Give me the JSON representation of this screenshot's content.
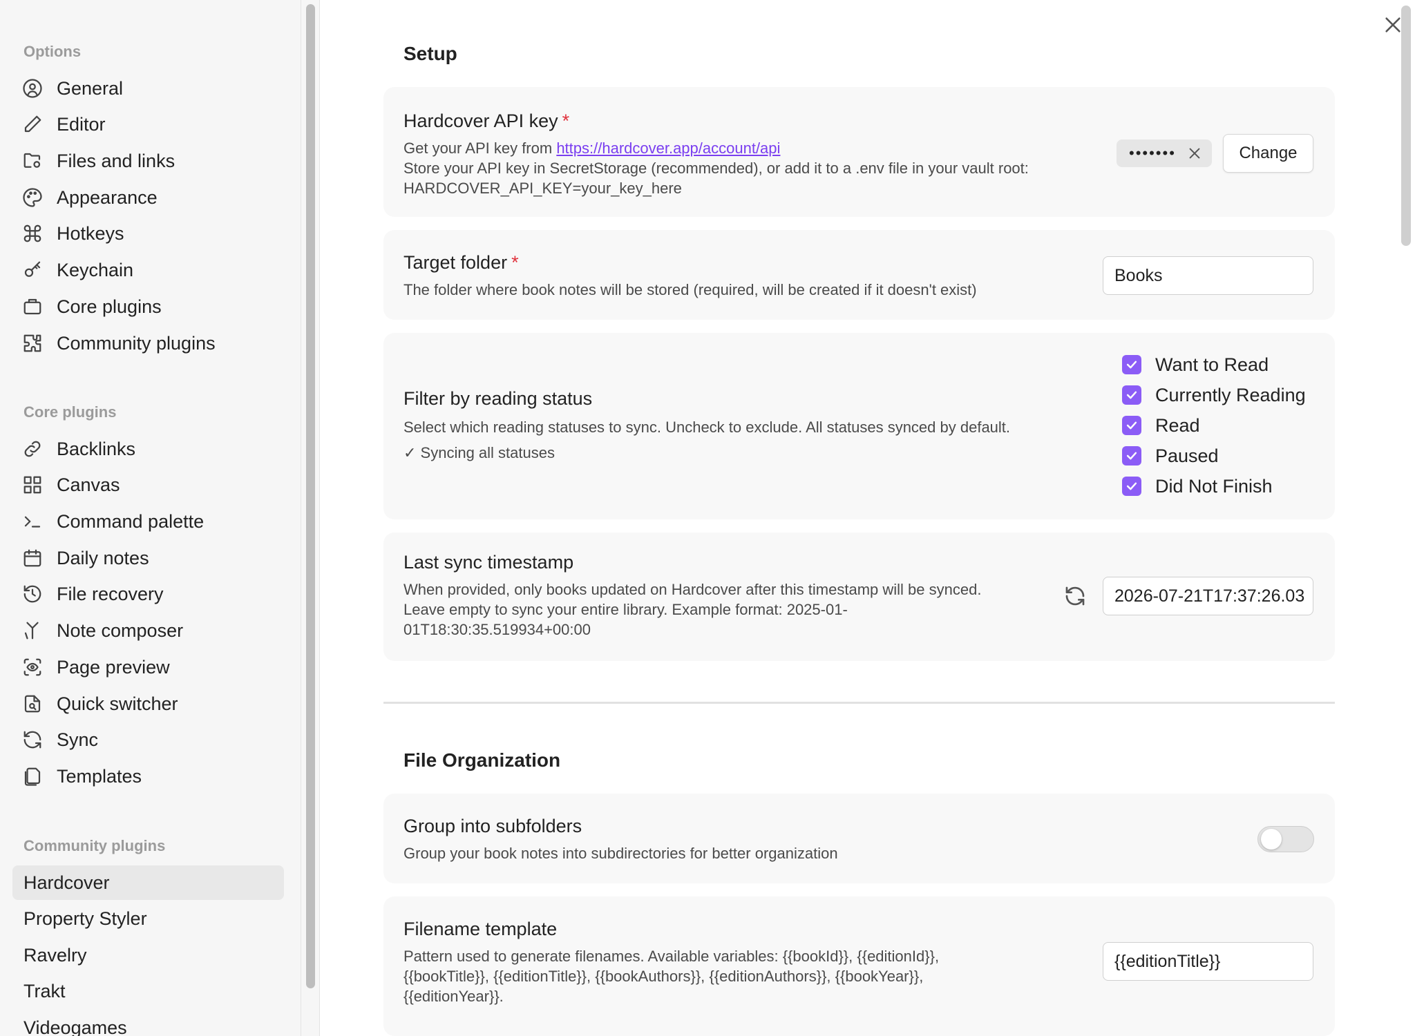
{
  "sidebar": {
    "options_title": "Options",
    "options_items": [
      {
        "label": "General",
        "icon": "user-circle-icon"
      },
      {
        "label": "Editor",
        "icon": "pencil-icon"
      },
      {
        "label": "Files and links",
        "icon": "folder-cog-icon"
      },
      {
        "label": "Appearance",
        "icon": "palette-icon"
      },
      {
        "label": "Hotkeys",
        "icon": "command-icon"
      },
      {
        "label": "Keychain",
        "icon": "key-icon"
      },
      {
        "label": "Core plugins",
        "icon": "briefcase-icon"
      },
      {
        "label": "Community plugins",
        "icon": "puzzle-icon"
      }
    ],
    "core_title": "Core plugins",
    "core_items": [
      {
        "label": "Backlinks",
        "icon": "link-icon"
      },
      {
        "label": "Canvas",
        "icon": "layout-grid-icon"
      },
      {
        "label": "Command palette",
        "icon": "terminal-icon"
      },
      {
        "label": "Daily notes",
        "icon": "calendar-icon"
      },
      {
        "label": "File recovery",
        "icon": "history-icon"
      },
      {
        "label": "Note composer",
        "icon": "merge-icon"
      },
      {
        "label": "Page preview",
        "icon": "scan-eye-icon"
      },
      {
        "label": "Quick switcher",
        "icon": "file-search-icon"
      },
      {
        "label": "Sync",
        "icon": "refresh-icon"
      },
      {
        "label": "Templates",
        "icon": "files-icon"
      }
    ],
    "community_title": "Community plugins",
    "community_items": [
      {
        "label": "Hardcover",
        "active": true
      },
      {
        "label": "Property Styler"
      },
      {
        "label": "Ravelry"
      },
      {
        "label": "Trakt"
      },
      {
        "label": "Videogames"
      }
    ]
  },
  "setup": {
    "heading": "Setup",
    "api_key": {
      "title": "Hardcover API key",
      "required_mark": "*",
      "desc_prefix": "Get your API key from ",
      "link": "https://hardcover.app/account/api",
      "desc_line2": "Store your API key in SecretStorage (recommended), or add it to a .env file in your vault root:",
      "desc_line3": "HARDCOVER_API_KEY=your_key_here",
      "masked_value": "•••••••",
      "change_label": "Change"
    },
    "target_folder": {
      "title": "Target folder",
      "required_mark": "*",
      "desc": "The folder where book notes will be stored (required, will be created if it doesn't exist)",
      "value": "Books"
    },
    "filter": {
      "title": "Filter by reading status",
      "desc": "Select which reading statuses to sync. Uncheck to exclude. All statuses synced by default.",
      "status_note": "✓ Syncing all statuses",
      "options": [
        {
          "label": "Want to Read",
          "checked": true
        },
        {
          "label": "Currently Reading",
          "checked": true
        },
        {
          "label": "Read",
          "checked": true
        },
        {
          "label": "Paused",
          "checked": true
        },
        {
          "label": "Did Not Finish",
          "checked": true
        }
      ]
    },
    "last_sync": {
      "title": "Last sync timestamp",
      "desc_line1": "When provided, only books updated on Hardcover after this timestamp will be synced.",
      "desc_line2": "Leave empty to sync your entire library. Example format: 2025-01-",
      "desc_line3": "01T18:30:35.519934+00:00",
      "value": "2026-07-21T17:37:26.03"
    }
  },
  "file_org": {
    "heading": "File Organization",
    "subfolders": {
      "title": "Group into subfolders",
      "desc": "Group your book notes into subdirectories for better organization",
      "enabled": false
    },
    "filename_template": {
      "title": "Filename template",
      "desc_line1": "Pattern used to generate filenames. Available variables: {{bookId}}, {{editionId}},",
      "desc_line2": "{{bookTitle}}, {{editionTitle}}, {{bookAuthors}}, {{editionAuthors}}, {{bookYear}},",
      "desc_line3": "{{editionYear}}.",
      "value": "{{editionTitle}}"
    }
  },
  "colors": {
    "accent": "#8b5cf6",
    "required": "#e0323d",
    "link": "#7a3ef0"
  }
}
